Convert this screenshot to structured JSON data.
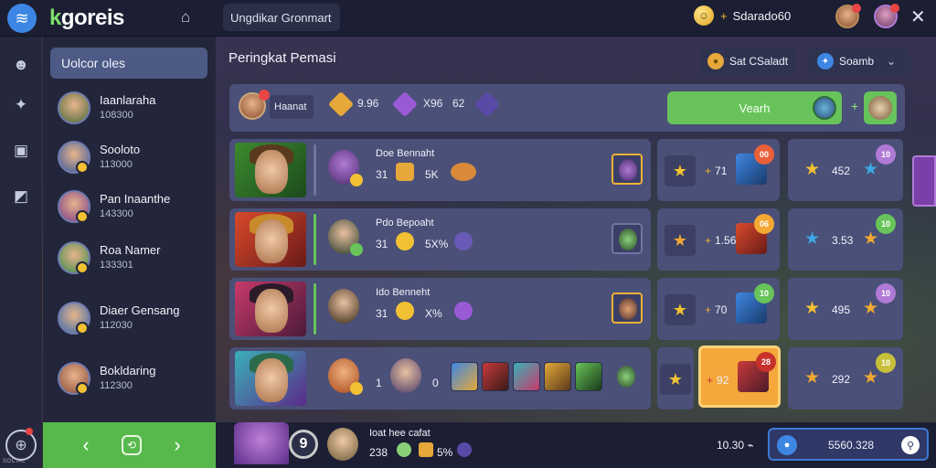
{
  "topbar": {
    "logo_prefix": "k",
    "logo": "goreis",
    "search_text": "Ungdikar Gronmart",
    "currency_value": "Sdarado60",
    "close_glyph": "✕"
  },
  "rail": {
    "bottom_label": "SOCIAL"
  },
  "friends": {
    "header": "Uolcor oles",
    "items": [
      {
        "name": "Iaanlaraha",
        "score": "108300"
      },
      {
        "name": "Sooloto",
        "score": "113000"
      },
      {
        "name": "Pan Inaanthe",
        "score": "143300"
      },
      {
        "name": "Roa Namer",
        "score": "133301"
      },
      {
        "name": "Diaer Gensang",
        "score": "112030"
      },
      {
        "name": "Bokldaring",
        "score": "112300"
      }
    ]
  },
  "main": {
    "title": "Peringkat Pemasi",
    "filter1": "Sat CSaladt",
    "filter2": "Soamb"
  },
  "summary": {
    "name": "Haanat",
    "val1": "9.96",
    "val2": "X96",
    "val3": "62",
    "vs_button": "Vearh"
  },
  "rows": [
    {
      "label": "Doe Bennaht",
      "v1": "31",
      "v2": "5K"
    },
    {
      "label": "Pdo Bepoaht",
      "v1": "31",
      "v2": "5X%"
    },
    {
      "label": "Ido Benneht",
      "v1": "31",
      "v2": "X%"
    },
    {
      "label": "",
      "v1": "1",
      "v2": "0"
    }
  ],
  "stats_left": [
    "71",
    "1.56",
    "70",
    "92"
  ],
  "stats_right": [
    "452",
    "3.53",
    "495",
    "292"
  ],
  "badges_left": [
    "00",
    "06",
    "10",
    "28"
  ],
  "badges_right": [
    "10",
    "10",
    "10",
    "10"
  ],
  "bottom": {
    "level": "9",
    "name": "Ioat hee cafat",
    "stat1": "238",
    "stat2": "5%",
    "time": "10.30",
    "search_value": "5560.328"
  },
  "icons": {
    "menu": "menu-icon",
    "home": "home-icon",
    "coin": "coin-icon",
    "search": "search-icon",
    "star": "star-icon"
  }
}
